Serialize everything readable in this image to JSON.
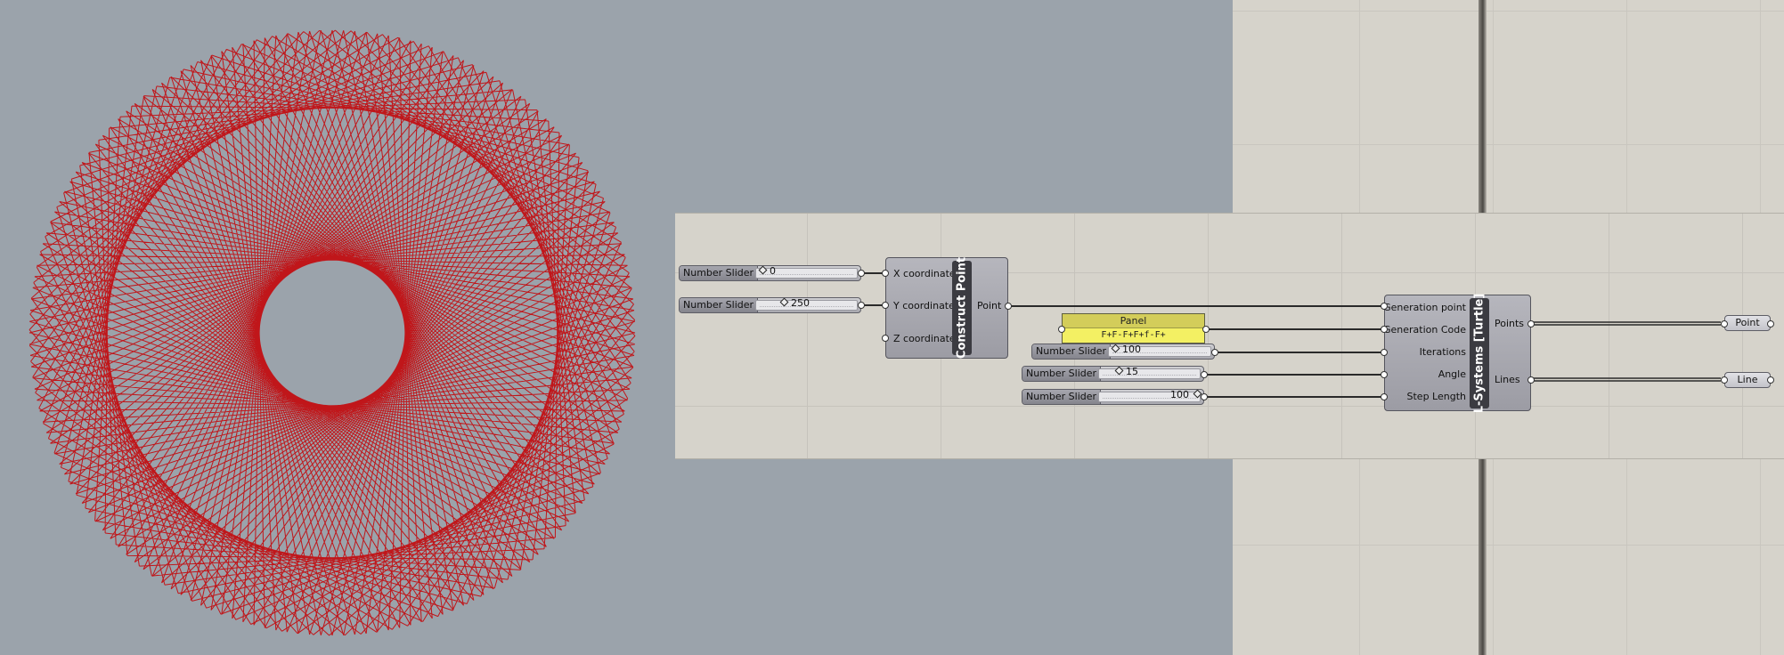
{
  "sliders": [
    {
      "label": "Number Slider",
      "value": "0"
    },
    {
      "label": "Number Slider",
      "value": "250"
    },
    {
      "label": "Number Slider",
      "value": "100"
    },
    {
      "label": "Number Slider",
      "value": "15"
    },
    {
      "label": "Number Slider",
      "value": "100"
    }
  ],
  "construct_point": {
    "title": "Construct Point",
    "inputs": [
      "X coordinate",
      "Y coordinate",
      "Z coordinate"
    ],
    "output": "Point"
  },
  "panel": {
    "title": "Panel",
    "text": "F+F-F+F+f-F+"
  },
  "lsystem": {
    "title": "L-Systems [Turtle]",
    "inputs": [
      "Generation point",
      "Generation Code",
      "Iterations",
      "Angle",
      "Step Length"
    ],
    "outputs": [
      "Points",
      "Lines"
    ]
  },
  "params": {
    "point": "Point",
    "line": "Line"
  },
  "colors": {
    "viewport_bg": "#9ba3ab",
    "curve": "#c0161a",
    "canvas": "#d6d3cb",
    "panel": "#f3f063"
  }
}
